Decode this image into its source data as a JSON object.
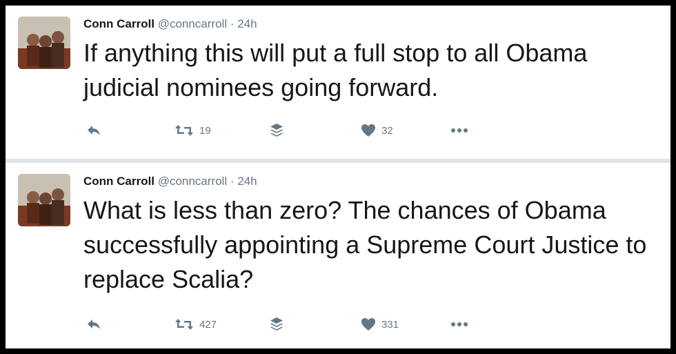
{
  "tweets": [
    {
      "author_name": "Conn Carroll",
      "author_handle": "@conncarroll",
      "separator": "·",
      "time": "24h",
      "text": "If anything this will put a full stop to all Obama judicial nominees going forward.",
      "retweets": "19",
      "likes": "32"
    },
    {
      "author_name": "Conn Carroll",
      "author_handle": "@conncarroll",
      "separator": "·",
      "time": "24h",
      "text": "What is less than zero? The chances of Obama successfully appointing a Supreme Court Justice to replace Scalia?",
      "retweets": "427",
      "likes": "331"
    }
  ],
  "icons": {
    "reply": "reply-icon",
    "retweet": "retweet-icon",
    "buffer": "layers-icon",
    "like": "heart-icon",
    "more": "more-icon"
  },
  "colors": {
    "text": "#14171a",
    "secondary": "#657786",
    "separator": "#dfe5ea",
    "border": "#000000"
  }
}
